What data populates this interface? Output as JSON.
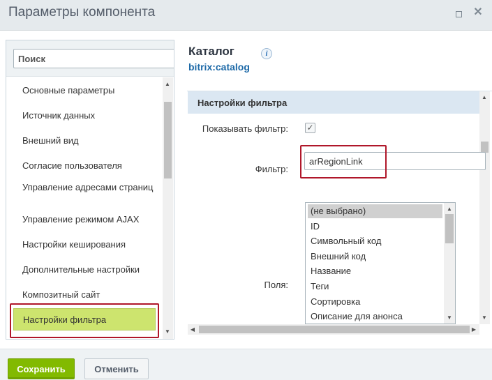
{
  "dialog": {
    "title": "Параметры компонента",
    "maximize_icon": "maximize-icon",
    "close_icon": "close-icon"
  },
  "sidebar": {
    "search_placeholder": "Поиск",
    "items": [
      {
        "label": "Основные параметры"
      },
      {
        "label": "Источник данных"
      },
      {
        "label": "Внешний вид"
      },
      {
        "label": "Согласие пользователя"
      },
      {
        "label": "Управление адресами страниц"
      },
      {
        "label": "Управление режимом AJAX"
      },
      {
        "label": "Настройки кеширования"
      },
      {
        "label": "Дополнительные настройки"
      },
      {
        "label": "Композитный сайт"
      },
      {
        "label": "Настройки фильтра",
        "active": true
      }
    ]
  },
  "component": {
    "title": "Каталог",
    "code": "bitrix:catalog",
    "info_icon": "i"
  },
  "section": {
    "title": "Настройки фильтра",
    "show_filter_label": "Показывать фильтр:",
    "show_filter_checked": true,
    "checkmark": "✓",
    "filter_label": "Фильтр:",
    "filter_value": "arRegionLink",
    "fields_label": "Поля:",
    "fields_options": [
      {
        "label": "(не выбрано)",
        "selected": true
      },
      {
        "label": "ID"
      },
      {
        "label": "Символьный код"
      },
      {
        "label": "Внешний код"
      },
      {
        "label": "Название"
      },
      {
        "label": "Теги"
      },
      {
        "label": "Сортировка"
      },
      {
        "label": "Описание для анонса"
      }
    ]
  },
  "footer": {
    "save_label": "Сохранить",
    "cancel_label": "Отменить"
  },
  "colors": {
    "active_item": "#cde46e",
    "highlight_outline": "#b0172a",
    "save_button": "#82ba00",
    "section_header": "#dbe7f2",
    "link": "#1e6aa8"
  }
}
